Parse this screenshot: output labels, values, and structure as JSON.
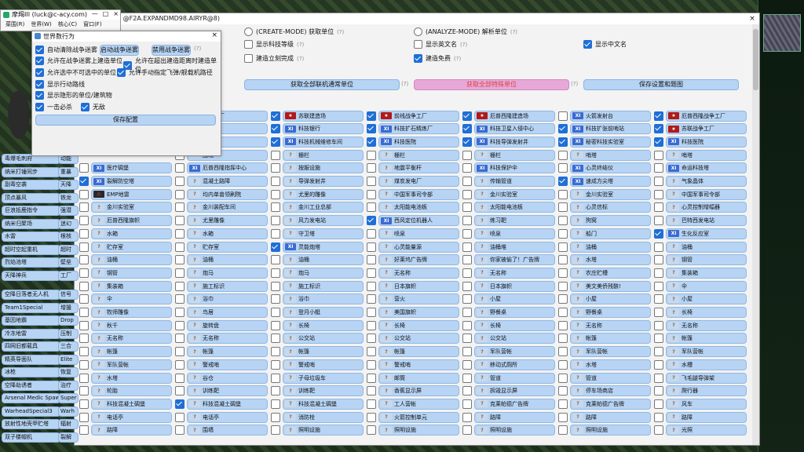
{
  "app": {
    "title": "摩羯III (luck@c-acy.com)",
    "menu": [
      "菜围(R)",
      "世界(W)",
      "核心(C)",
      "窗口(F)"
    ],
    "ctrl_min": "—",
    "ctrl_max": "□",
    "ctrl_close": "×"
  },
  "main": {
    "title": "( @F2A.EXPANDMD98.AIRYR@8)",
    "close": "×",
    "options": [
      {
        "label": "(CREATE-MODE) 获取单位",
        "hint": "(?)",
        "checked": false
      },
      {
        "label": "(ANALYZE-MODE) 解析单位",
        "hint": "(?)",
        "checked": false
      },
      {
        "label": "显示科技等级",
        "hint": "(?)",
        "checked": false
      },
      {
        "label": "显示英文名",
        "hint": "(?)",
        "checked": false
      },
      {
        "label": "显示中文名",
        "hint": "",
        "checked": true
      },
      {
        "label": "建造立刻完成",
        "hint": "(?)",
        "checked": false
      },
      {
        "label": "建造免费",
        "hint": "(?)",
        "checked": true
      }
    ],
    "buttons": {
      "get_all": "获取全部联机通常单位",
      "hint_get": "(?)",
      "get_special": "获取全部特殊单位",
      "hint_special": "(?)",
      "save": "保存设置和题图"
    },
    "rows": [
      [
        [
          "on",
          "em",
          "战争工厂"
        ],
        [
          "on",
          "su",
          "苏联建造场"
        ],
        [
          "on",
          "su",
          "前线战争工厂"
        ],
        [
          "on",
          "su",
          "厄普西隆建造场"
        ],
        [
          "off",
          "xi",
          "火箭发射台"
        ],
        [
          "on",
          "su",
          "厄普西隆战争工厂"
        ]
      ],
      [
        [
          "on",
          "q",
          "技机场"
        ],
        [
          "on",
          "xi",
          "科技银行"
        ],
        [
          "on",
          "xi",
          "科技扩石精炼厂"
        ],
        [
          "on",
          "xi",
          "科技卫星入侵中心"
        ],
        [
          "on",
          "xi",
          "科技扩张前哨站"
        ],
        [
          "on",
          "su",
          "苏联战争工厂"
        ]
      ],
      [
        [
          "off",
          "q",
          "发电厂"
        ],
        [
          "on",
          "xi",
          "科技机械维修车间"
        ],
        [
          "on",
          "xi",
          "科技医院"
        ],
        [
          "on",
          "xi",
          "科技导弹发射井"
        ],
        [
          "on",
          "xi",
          "秘密科技实验室"
        ],
        [
          "on",
          "xi",
          "科技医院"
        ]
      ],
      [
        [
          "off",
          "q",
          "围墙"
        ],
        [
          "off",
          "q",
          "栅栏"
        ],
        [
          "off",
          "q",
          "栅栏"
        ],
        [
          "off",
          "q",
          "栅栏"
        ],
        [
          "off",
          "q",
          "哨塔"
        ],
        [
          "off",
          "q",
          "哨塔"
        ]
      ],
      [
        [
          "off",
          "xi",
          "医疗碉堡"
        ],
        [
          "off",
          "xi",
          "厄普西隆指挥中心"
        ],
        [
          "off",
          "q",
          "按服设施"
        ],
        [
          "off",
          "q",
          "地震平衡杆"
        ],
        [
          "off",
          "xi",
          "科技保护伞"
        ],
        [
          "off",
          "xi",
          "心灵终结仪"
        ],
        [
          "off",
          "xi",
          "命运科技塔"
        ]
      ],
      [
        [
          "on",
          "xi",
          "裂解防空塔"
        ],
        [
          "off",
          "q",
          "混凝土路障"
        ],
        [
          "off",
          "q",
          "导弹发射井"
        ],
        [
          "off",
          "q",
          "煤炭发电厂"
        ],
        [
          "off",
          "q",
          "传输管道"
        ],
        [
          "on",
          "xi",
          "速成方尖塔"
        ],
        [
          "off",
          "q",
          "气象晶体"
        ]
      ],
      [
        [
          "off",
          "em",
          "EMP地雷"
        ],
        [
          "off",
          "q",
          "均内单兽领刷院"
        ],
        [
          "off",
          "q",
          "尤里的雕像"
        ],
        [
          "off",
          "q",
          "中国军事司令部"
        ],
        [
          "off",
          "q",
          "金川实验室"
        ],
        [
          "off",
          "q",
          "金川实验室"
        ],
        [
          "off",
          "q",
          "中国军事司令部"
        ]
      ],
      [
        [
          "off",
          "q",
          "金川实验室"
        ],
        [
          "off",
          "q",
          "金川装配车间"
        ],
        [
          "off",
          "q",
          "金川工业总部"
        ],
        [
          "off",
          "q",
          "太阳能电池板"
        ],
        [
          "off",
          "q",
          "太阳能电池板"
        ],
        [
          "off",
          "q",
          "心灵信标"
        ],
        [
          "off",
          "q",
          "心灵控制增幅器"
        ]
      ],
      [
        [
          "off",
          "q",
          "厄普西隆旗帜"
        ],
        [
          "off",
          "q",
          "尤里雕像"
        ],
        [
          "off",
          "q",
          "风力发电站"
        ],
        [
          "on",
          "xi",
          "西风定位机器人"
        ],
        [
          "off",
          "q",
          "练习靶"
        ],
        [
          "off",
          "q",
          "狗窝"
        ],
        [
          "off",
          "q",
          "巴特西发电站"
        ]
      ],
      [
        [
          "off",
          "q",
          "水箱"
        ],
        [
          "off",
          "q",
          "水箱"
        ],
        [
          "off",
          "q",
          "守卫塔"
        ],
        [
          "off",
          "q",
          "喷泉"
        ],
        [
          "off",
          "q",
          "喷泉"
        ],
        [
          "off",
          "q",
          "船门"
        ],
        [
          "on",
          "xi",
          "生化反应室"
        ]
      ],
      [
        [
          "off",
          "q",
          "贮存室"
        ],
        [
          "off",
          "q",
          "贮存室"
        ],
        [
          "on",
          "xi",
          "灵能炮塔"
        ],
        [
          "off",
          "q",
          "心灵能量源"
        ],
        [
          "off",
          "q",
          "油桶堆"
        ],
        [
          "off",
          "q",
          "油桶"
        ],
        [
          "off",
          "q",
          "油桶"
        ]
      ],
      [
        [
          "off",
          "q",
          "油桶"
        ],
        [
          "off",
          "q",
          "油桶"
        ],
        [
          "off",
          "q",
          "油桶"
        ],
        [
          "off",
          "q",
          "好莱坞广告牌"
        ],
        [
          "off",
          "q",
          "你家被偷了！广告牌"
        ],
        [
          "off",
          "q",
          "水塔"
        ],
        [
          "off",
          "q",
          "钢管"
        ]
      ],
      [
        [
          "off",
          "q",
          "钢管"
        ],
        [
          "off",
          "q",
          "炮马"
        ],
        [
          "off",
          "q",
          "炮马"
        ],
        [
          "off",
          "q",
          "无名称"
        ],
        [
          "off",
          "q",
          "无名称"
        ],
        [
          "off",
          "q",
          "农庄贮槽"
        ],
        [
          "off",
          "q",
          "集装箱"
        ]
      ],
      [
        [
          "off",
          "q",
          "集装箱"
        ],
        [
          "off",
          "q",
          "施工标识"
        ],
        [
          "off",
          "q",
          "施工标识"
        ],
        [
          "off",
          "q",
          "日本旗帜"
        ],
        [
          "off",
          "q",
          "日本旗帜"
        ],
        [
          "off",
          "q",
          "美文美侨残骸!"
        ],
        [
          "off",
          "q",
          "伞"
        ]
      ],
      [
        [
          "off",
          "q",
          "伞"
        ],
        [
          "off",
          "q",
          "浴巾"
        ],
        [
          "off",
          "q",
          "浴巾"
        ],
        [
          "off",
          "q",
          "营火"
        ],
        [
          "off",
          "q",
          "小屋"
        ],
        [
          "off",
          "q",
          "小屋"
        ],
        [
          "off",
          "q",
          "小屋"
        ]
      ],
      [
        [
          "off",
          "q",
          "牧师雕像"
        ],
        [
          "off",
          "q",
          "鸟居"
        ],
        [
          "off",
          "q",
          "登月小艇"
        ],
        [
          "off",
          "q",
          "美国旗帜"
        ],
        [
          "off",
          "q",
          "野餐桌"
        ],
        [
          "off",
          "q",
          "野餐桌"
        ],
        [
          "off",
          "q",
          "长椅"
        ]
      ],
      [
        [
          "off",
          "q",
          "秋千"
        ],
        [
          "off",
          "q",
          "旋转盘"
        ],
        [
          "off",
          "q",
          "长椅"
        ],
        [
          "off",
          "q",
          "长椅"
        ],
        [
          "off",
          "q",
          "长椅"
        ],
        [
          "off",
          "q",
          "无名称"
        ],
        [
          "off",
          "q",
          "无名称"
        ]
      ],
      [
        [
          "off",
          "q",
          "无名称"
        ],
        [
          "off",
          "q",
          "无名称"
        ],
        [
          "off",
          "q",
          "公交站"
        ],
        [
          "off",
          "q",
          "公交站"
        ],
        [
          "off",
          "q",
          "公交站"
        ],
        [
          "off",
          "q",
          "帐篷"
        ],
        [
          "off",
          "q",
          "帐篷"
        ]
      ],
      [
        [
          "off",
          "q",
          "帐篷"
        ],
        [
          "off",
          "q",
          "帐篷"
        ],
        [
          "off",
          "q",
          "帐篷"
        ],
        [
          "off",
          "q",
          "帐篷"
        ],
        [
          "off",
          "q",
          "军队营帐"
        ],
        [
          "off",
          "q",
          "军队营帐"
        ],
        [
          "off",
          "q",
          "军队营帐"
        ]
      ],
      [
        [
          "off",
          "q",
          "军队营帐"
        ],
        [
          "off",
          "q",
          "警戒哨"
        ],
        [
          "off",
          "q",
          "警戒哨"
        ],
        [
          "off",
          "q",
          "警戒哨"
        ],
        [
          "off",
          "q",
          "移动式厕所"
        ],
        [
          "off",
          "q",
          "水塔"
        ],
        [
          "off",
          "q",
          "水槽"
        ]
      ],
      [
        [
          "off",
          "q",
          "水塔"
        ],
        [
          "off",
          "q",
          "谷仓"
        ],
        [
          "off",
          "q",
          "子母垃圾车"
        ],
        [
          "off",
          "q",
          "邮筒"
        ],
        [
          "off",
          "q",
          "管道"
        ],
        [
          "off",
          "q",
          "管道"
        ],
        [
          "off",
          "q",
          "飞毛腿导弹架"
        ]
      ],
      [
        [
          "off",
          "q",
          "轮胎"
        ],
        [
          "off",
          "q",
          "训练靶"
        ],
        [
          "off",
          "q",
          "训练靶"
        ],
        [
          "off",
          "q",
          "香蕉显示屏"
        ],
        [
          "off",
          "q",
          "拆毁显示屏"
        ],
        [
          "off",
          "q",
          "停车场商店"
        ],
        [
          "off",
          "q",
          "爬行器"
        ]
      ],
      [
        [
          "off",
          "q",
          "科技混凝土碉堡"
        ],
        [
          "on",
          "q",
          "科技混凝土碉堡"
        ],
        [
          "off",
          "q",
          "科技混凝土碉堡"
        ],
        [
          "off",
          "q",
          "工人营帐"
        ],
        [
          "off",
          "q",
          "克莱帕德广告牌"
        ],
        [
          "off",
          "q",
          "克莱帕德广告牌"
        ],
        [
          "off",
          "q",
          "风车"
        ]
      ],
      [
        [
          "off",
          "q",
          "电话亭"
        ],
        [
          "off",
          "q",
          "电话亭"
        ],
        [
          "off",
          "q",
          "消防栓"
        ],
        [
          "off",
          "q",
          "火箭控制单元"
        ],
        [
          "off",
          "q",
          "路障"
        ],
        [
          "off",
          "q",
          "路障"
        ],
        [
          "off",
          "q",
          "路障"
        ]
      ],
      [
        [
          "off",
          "q",
          "路障"
        ],
        [
          "off",
          "q",
          "围墙"
        ],
        [
          "off",
          "q",
          "照明设施"
        ],
        [
          "off",
          "q",
          "照明设施"
        ],
        [
          "off",
          "q",
          "照明设施"
        ],
        [
          "off",
          "q",
          "照明设施"
        ],
        [
          "off",
          "q",
          "光照"
        ]
      ]
    ]
  },
  "left_list": [
    "毒爆毛刺府",
    "纳米打锤同步",
    "副毒空袭",
    "顶点暴风",
    "巨浪抵鹿指令",
    "纳米归聚场",
    "水雷",
    "超时空起重机",
    "烈焰池塔",
    "天降神兵",
    "空降日落者无人机",
    "Team1Special",
    "基因地霸",
    "冷冻地雷",
    "四网旧都载具",
    "精英导面队",
    "冰枪",
    "空降劫诱者",
    "Arsenal Medic Spaw",
    "WarheadSpecial3",
    "放射性地壳甲贮塔",
    "双子楼帽机"
  ],
  "left_list2": [
    "动能",
    "重暴",
    "天降",
    "铁龙",
    "强潜",
    "迷幻",
    "根核",
    "超时",
    "壁垒",
    "工厂",
    "信号",
    "增援",
    "Drop",
    "压制",
    "三合",
    "Elite",
    "恢复",
    "治疗",
    "Super",
    "Warh",
    "辐射",
    "裂解"
  ],
  "dialog": {
    "title": "世界数行为",
    "close": "×",
    "items": [
      {
        "label": "自动清除战争迷雾",
        "checked": true
      },
      {
        "label": "允许在战争迷雾上建造单位",
        "checked": true
      },
      {
        "label": "允许在超出建造距离时建造单位",
        "checked": true
      },
      {
        "label": "允许选中不可选中的单位",
        "checked": true
      },
      {
        "label": "允许手动指定飞弹/舰载机路径",
        "checked": true
      },
      {
        "label": "显示行动路线",
        "checked": true
      },
      {
        "label": "显示隐形的单位/建筑物",
        "checked": true
      },
      {
        "label": "一击必杀",
        "checked": true
      },
      {
        "label": "无敌",
        "checked": true
      }
    ],
    "fog_on": "启动战争迷雾",
    "fog_off": "禁用战争迷雾",
    "hint": "(?)",
    "save": "保存配置"
  }
}
